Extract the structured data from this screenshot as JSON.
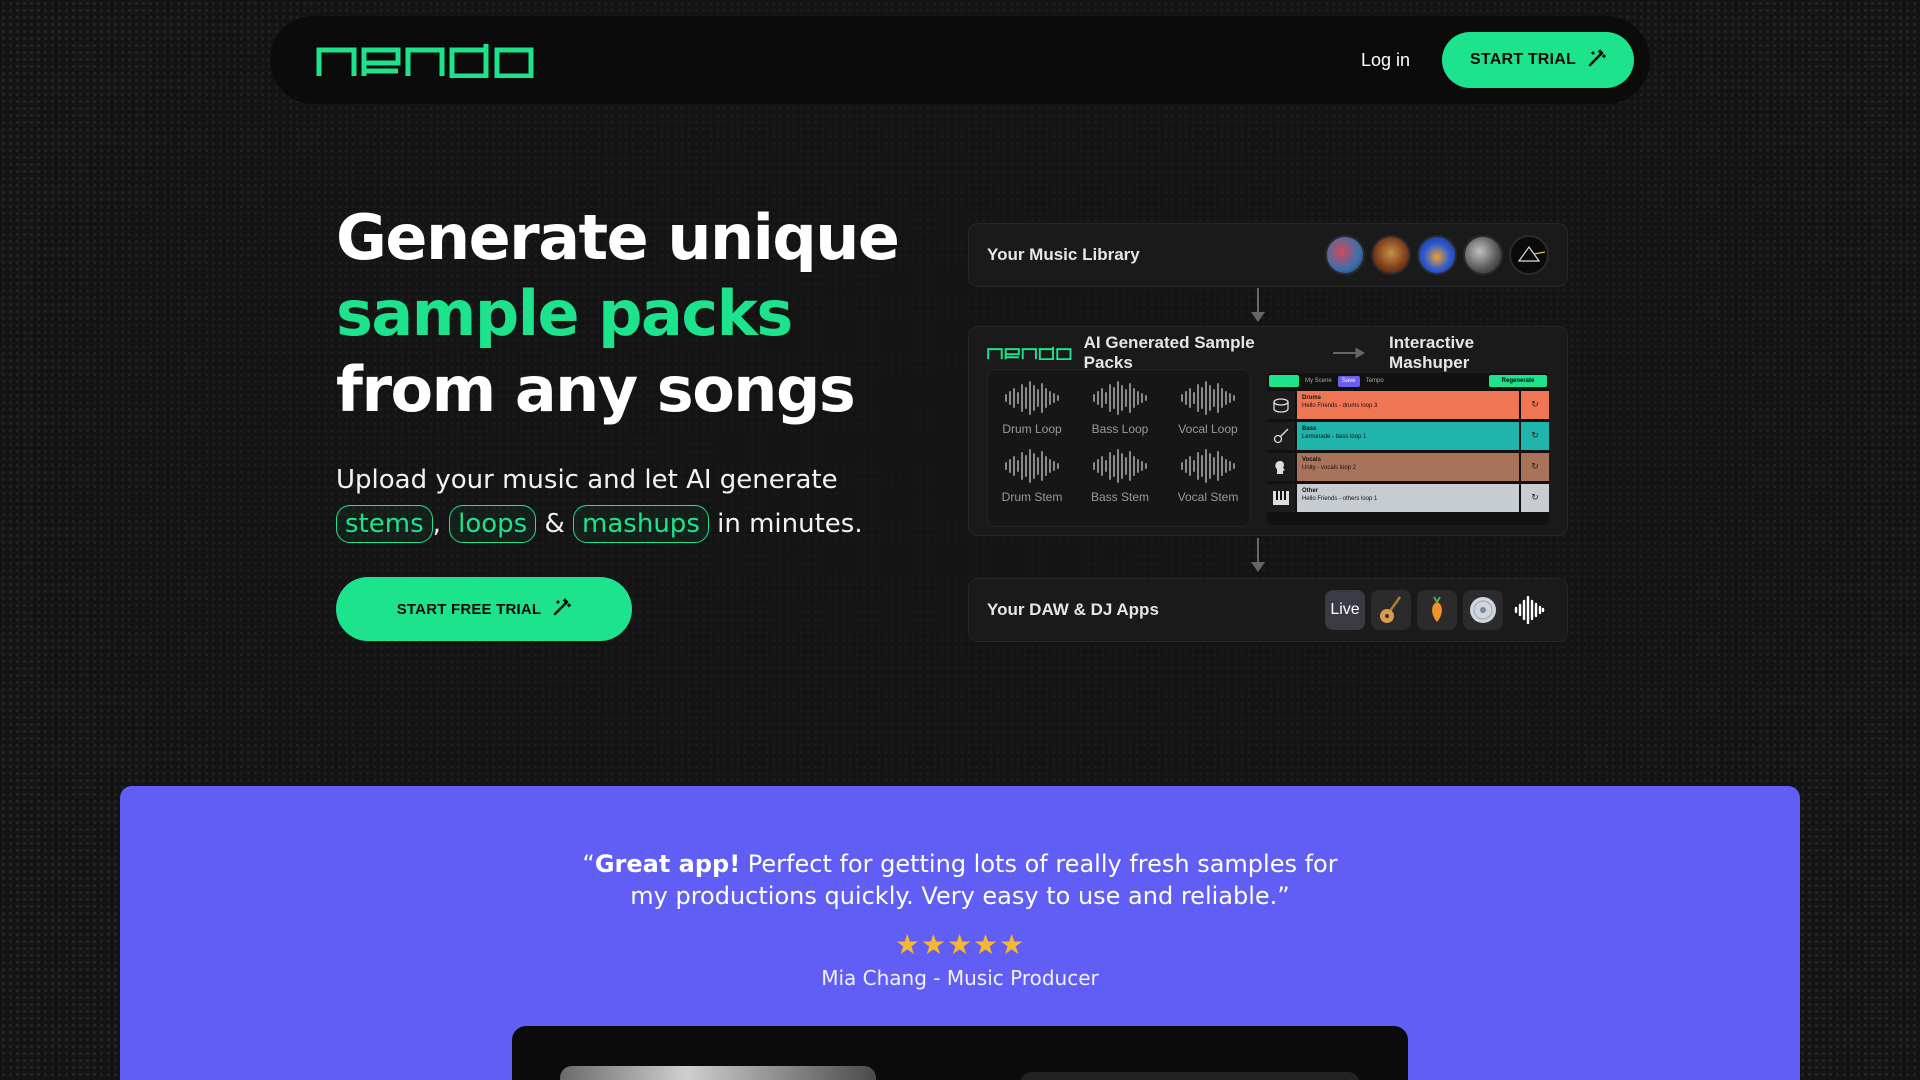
{
  "brand": {
    "name": "nendo",
    "accent": "#1de38c",
    "testimonial_bg": "#615ef5"
  },
  "nav": {
    "login": "Log in",
    "cta": "START TRIAL"
  },
  "hero": {
    "title_line1": "Generate unique",
    "title_line2": "sample packs",
    "title_line3": "from any songs",
    "sub_text": "Upload your music and let AI generate",
    "pill_stems": "stems",
    "sep_comma": ",",
    "pill_loops": "loops",
    "sep_amp": "&",
    "pill_mashups": "mashups",
    "sub_end": "in minutes.",
    "cta": "START FREE TRIAL"
  },
  "diagram": {
    "library_label": "Your Music Library",
    "ai_label": "AI Generated Sample Packs",
    "mashuper_label": "Interactive Mashuper",
    "loops": [
      "Drum Loop",
      "Bass Loop",
      "Vocal Loop",
      "Drum Stem",
      "Bass Stem",
      "Vocal Stem"
    ],
    "mashup": {
      "scene": "My Scene",
      "save": "Save",
      "tempo": "Tempo",
      "regen": "Regenerate",
      "tracks": [
        {
          "name": "Drums",
          "desc": "Hello Friends - drums loop 3",
          "color": "#ef7654"
        },
        {
          "name": "Bass",
          "desc": "Lemonade - bass loop 1",
          "color": "#1fb5ac"
        },
        {
          "name": "Vocals",
          "desc": "Unity - vocals loop 2",
          "color": "#a9735b"
        },
        {
          "name": "Other",
          "desc": "Hello Friends - others loop 1",
          "color": "#c7ccd0"
        }
      ]
    },
    "daw_label": "Your DAW & DJ Apps",
    "live_label": "Live"
  },
  "testimonial": {
    "quote_open": "“",
    "quote_bold": "Great app!",
    "quote_text": " Perfect for getting lots of really fresh samples for my productions quickly. Very easy to use and reliable.”",
    "stars": "★★★★★",
    "rating": 5,
    "author": "Mia Chang - Music Producer"
  }
}
